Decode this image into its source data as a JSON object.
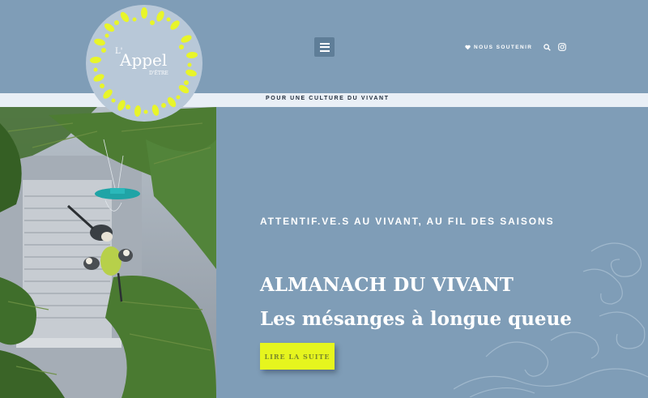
{
  "brand": {
    "logo_word_l": "L'",
    "logo_word_main": "Appel",
    "logo_word_sub": "D'ÊTRE"
  },
  "header": {
    "menu_icon": "hamburger-icon",
    "support_label": "NOUS SOUTENIR",
    "support_icon": "heart-icon",
    "search_icon": "search-icon",
    "social_icon": "instagram-icon"
  },
  "strip": {
    "text": "POUR UNE CULTURE DU VIVANT"
  },
  "hero": {
    "tagline": "ATTENTIF.VE.S AU VIVANT, AU FIL DES SAISONS",
    "section": "ALMANACH DU VIVANT",
    "title": "Les mésanges à longue queue",
    "cta_label": "LIRE LA SUITE"
  },
  "colors": {
    "background": "#7f9db7",
    "strip": "#e9eff6",
    "accent": "#e6f51e"
  }
}
